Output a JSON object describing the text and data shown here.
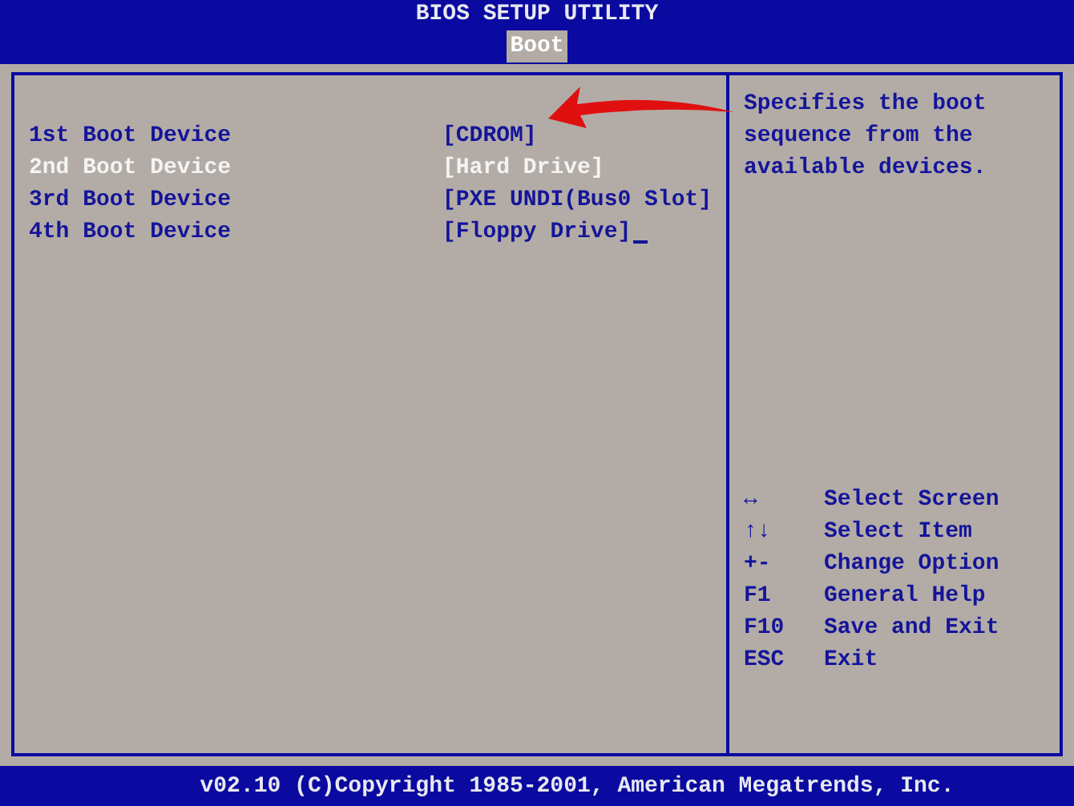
{
  "header": {
    "title": "BIOS SETUP UTILITY"
  },
  "tabs": [
    {
      "label": "Boot",
      "selected": true
    }
  ],
  "items": [
    {
      "label": "1st Boot Device",
      "value": "[CDROM]",
      "selected": false,
      "cursor": false
    },
    {
      "label": "2nd Boot Device",
      "value": "[Hard Drive]",
      "selected": true,
      "cursor": false
    },
    {
      "label": "3rd Boot Device",
      "value": "[PXE UNDI(Bus0 Slot]",
      "selected": false,
      "cursor": false
    },
    {
      "label": "4th Boot Device",
      "value": "[Floppy Drive]",
      "selected": false,
      "cursor": true
    }
  ],
  "help": "Specifies the boot sequence from the available devices.",
  "keys": [
    {
      "key": "↔",
      "action": "Select Screen"
    },
    {
      "key": "↑↓",
      "action": "Select Item"
    },
    {
      "key": "+-",
      "action": "Change Option"
    },
    {
      "key": "F1",
      "action": "General Help"
    },
    {
      "key": "F10",
      "action": "Save and Exit"
    },
    {
      "key": "ESC",
      "action": "Exit"
    }
  ],
  "footer": "v02.10 (C)Copyright 1985-2001, American Megatrends, Inc."
}
